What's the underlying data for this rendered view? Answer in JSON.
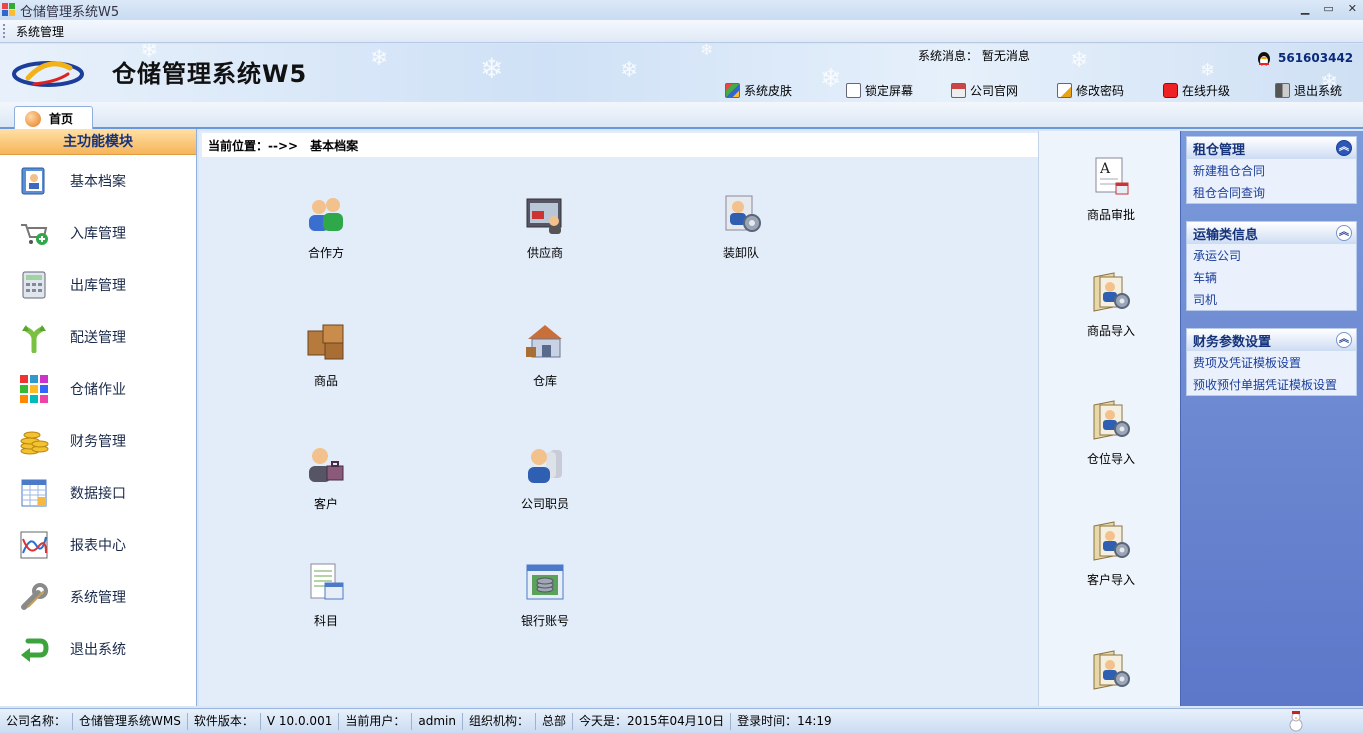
{
  "window": {
    "title": "仓储管理系统W5"
  },
  "menu": {
    "items": [
      "系统管理"
    ]
  },
  "header": {
    "app_name": "仓储管理系统W5",
    "sys_msg_label": "系统消息：",
    "sys_msg_value": "暂无消息",
    "qq_number": "561603442",
    "toolbar": [
      {
        "label": "系统皮肤",
        "icon": "skin-icon"
      },
      {
        "label": "锁定屏幕",
        "icon": "lock-screen-icon"
      },
      {
        "label": "公司官网",
        "icon": "home-icon"
      },
      {
        "label": "修改密码",
        "icon": "edit-password-icon"
      },
      {
        "label": "在线升级",
        "icon": "upgrade-icon"
      },
      {
        "label": "退出系统",
        "icon": "exit-icon"
      }
    ]
  },
  "tabs": [
    {
      "label": "首页"
    }
  ],
  "left_panel": {
    "title": "主功能模块",
    "items": [
      {
        "label": "基本档案",
        "icon": "archive-icon"
      },
      {
        "label": "入库管理",
        "icon": "cart-add-icon"
      },
      {
        "label": "出库管理",
        "icon": "calculator-icon"
      },
      {
        "label": "配送管理",
        "icon": "fork-arrow-icon"
      },
      {
        "label": "仓储作业",
        "icon": "grid-blocks-icon"
      },
      {
        "label": "财务管理",
        "icon": "coins-icon"
      },
      {
        "label": "数据接口",
        "icon": "spreadsheet-icon"
      },
      {
        "label": "报表中心",
        "icon": "chart-icon"
      },
      {
        "label": "系统管理",
        "icon": "wrench-icon"
      },
      {
        "label": "退出系统",
        "icon": "return-arrow-icon"
      }
    ]
  },
  "content": {
    "breadcrumb_label": "当前位置：-->>",
    "breadcrumb_value": "基本档案",
    "items": [
      {
        "label": "合作方",
        "icon": "partners-icon"
      },
      {
        "label": "供应商",
        "icon": "supplier-icon"
      },
      {
        "label": "装卸队",
        "icon": "loading-team-icon"
      },
      {
        "label": "商品",
        "icon": "goods-boxes-icon"
      },
      {
        "label": "仓库",
        "icon": "warehouse-icon"
      },
      {
        "label": "客户",
        "icon": "customer-icon"
      },
      {
        "label": "公司职员",
        "icon": "staff-icon"
      },
      {
        "label": "科目",
        "icon": "subject-icon"
      },
      {
        "label": "银行账号",
        "icon": "bank-account-icon"
      }
    ]
  },
  "right_column": {
    "items": [
      {
        "label": "商品审批",
        "icon": "approval-icon"
      },
      {
        "label": "商品导入",
        "icon": "import-icon"
      },
      {
        "label": "仓位导入",
        "icon": "import-icon"
      },
      {
        "label": "客户导入",
        "icon": "import-icon"
      },
      {
        "label": "",
        "icon": "import-icon"
      }
    ]
  },
  "far_right": {
    "groups": [
      {
        "title": "租仓管理",
        "links": [
          "新建租仓合同",
          "租仓合同查询"
        ]
      },
      {
        "title": "运输类信息",
        "links": [
          "承运公司",
          "车辆",
          "司机"
        ]
      },
      {
        "title": "财务参数设置",
        "links": [
          "费项及凭证模板设置",
          "预收预付单据凭证模板设置"
        ]
      }
    ]
  },
  "status": {
    "company_label": "公司名称：",
    "company_value": "仓储管理系统WMS",
    "version_label": "软件版本：",
    "version_value": "V 10.0.001",
    "user_label": "当前用户：",
    "user_value": "admin",
    "org_label": "组织机构：",
    "org_value": "总部",
    "today": "今天是：2015年04月10日",
    "login_time": "登录时间：14:19"
  }
}
